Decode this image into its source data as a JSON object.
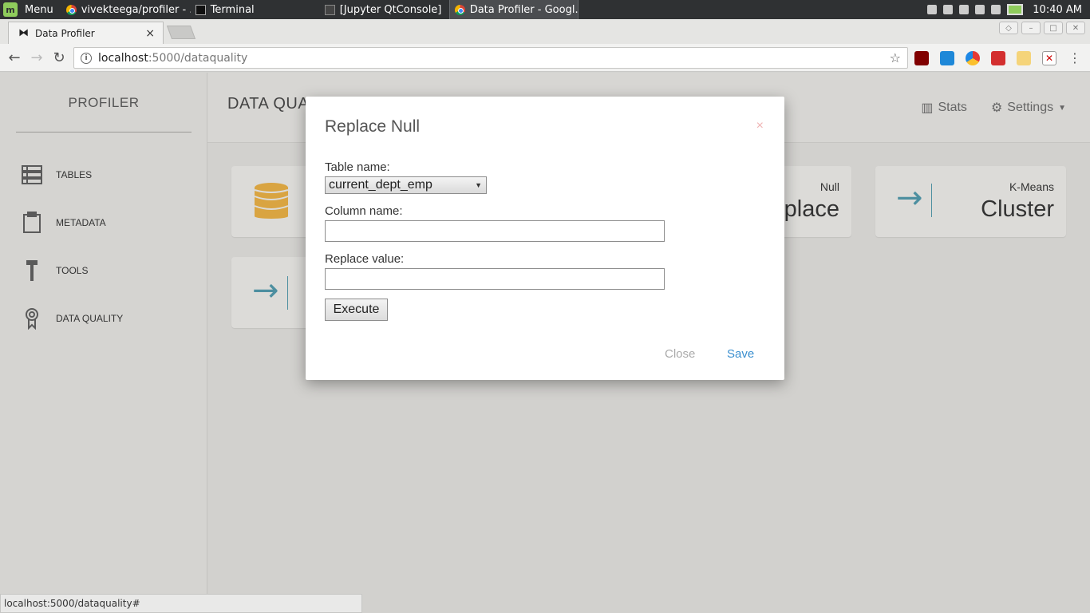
{
  "taskbar": {
    "menu_label": "Menu",
    "tasks": [
      {
        "label": "vivekteega/profiler - ...",
        "icon": "chrome-icon"
      },
      {
        "label": "Terminal",
        "icon": "terminal-icon"
      },
      {
        "label": "[Jupyter QtConsole]",
        "icon": "jupyter-icon"
      },
      {
        "label": "Data Profiler - Googl...",
        "icon": "chrome-icon"
      }
    ],
    "clock": "10:40 AM"
  },
  "browser": {
    "tab_title": "Data Profiler",
    "tab_close": "×",
    "url_host": "localhost",
    "url_path": ":5000/dataquality",
    "status_url": "localhost:5000/dataquality#"
  },
  "sidebar": {
    "brand": "PROFILER",
    "items": [
      {
        "label": "TABLES",
        "icon": "tables-icon"
      },
      {
        "label": "METADATA",
        "icon": "clipboard-icon"
      },
      {
        "label": "TOOLS",
        "icon": "hammer-icon"
      },
      {
        "label": "DATA QUALITY",
        "icon": "award-icon"
      }
    ]
  },
  "header": {
    "title": "DATA QUA",
    "stats_label": "Stats",
    "settings_label": "Settings"
  },
  "cards": [
    {
      "small": "Null",
      "big": "place"
    },
    {
      "small": "K-Means",
      "big": "Cluster"
    }
  ],
  "modal": {
    "title": "Replace Null",
    "close_x": "×",
    "table_label": "Table name:",
    "table_value": "current_dept_emp",
    "column_label": "Column name:",
    "column_value": "",
    "replace_label": "Replace value:",
    "replace_value": "",
    "execute_label": "Execute",
    "close_label": "Close",
    "save_label": "Save"
  }
}
